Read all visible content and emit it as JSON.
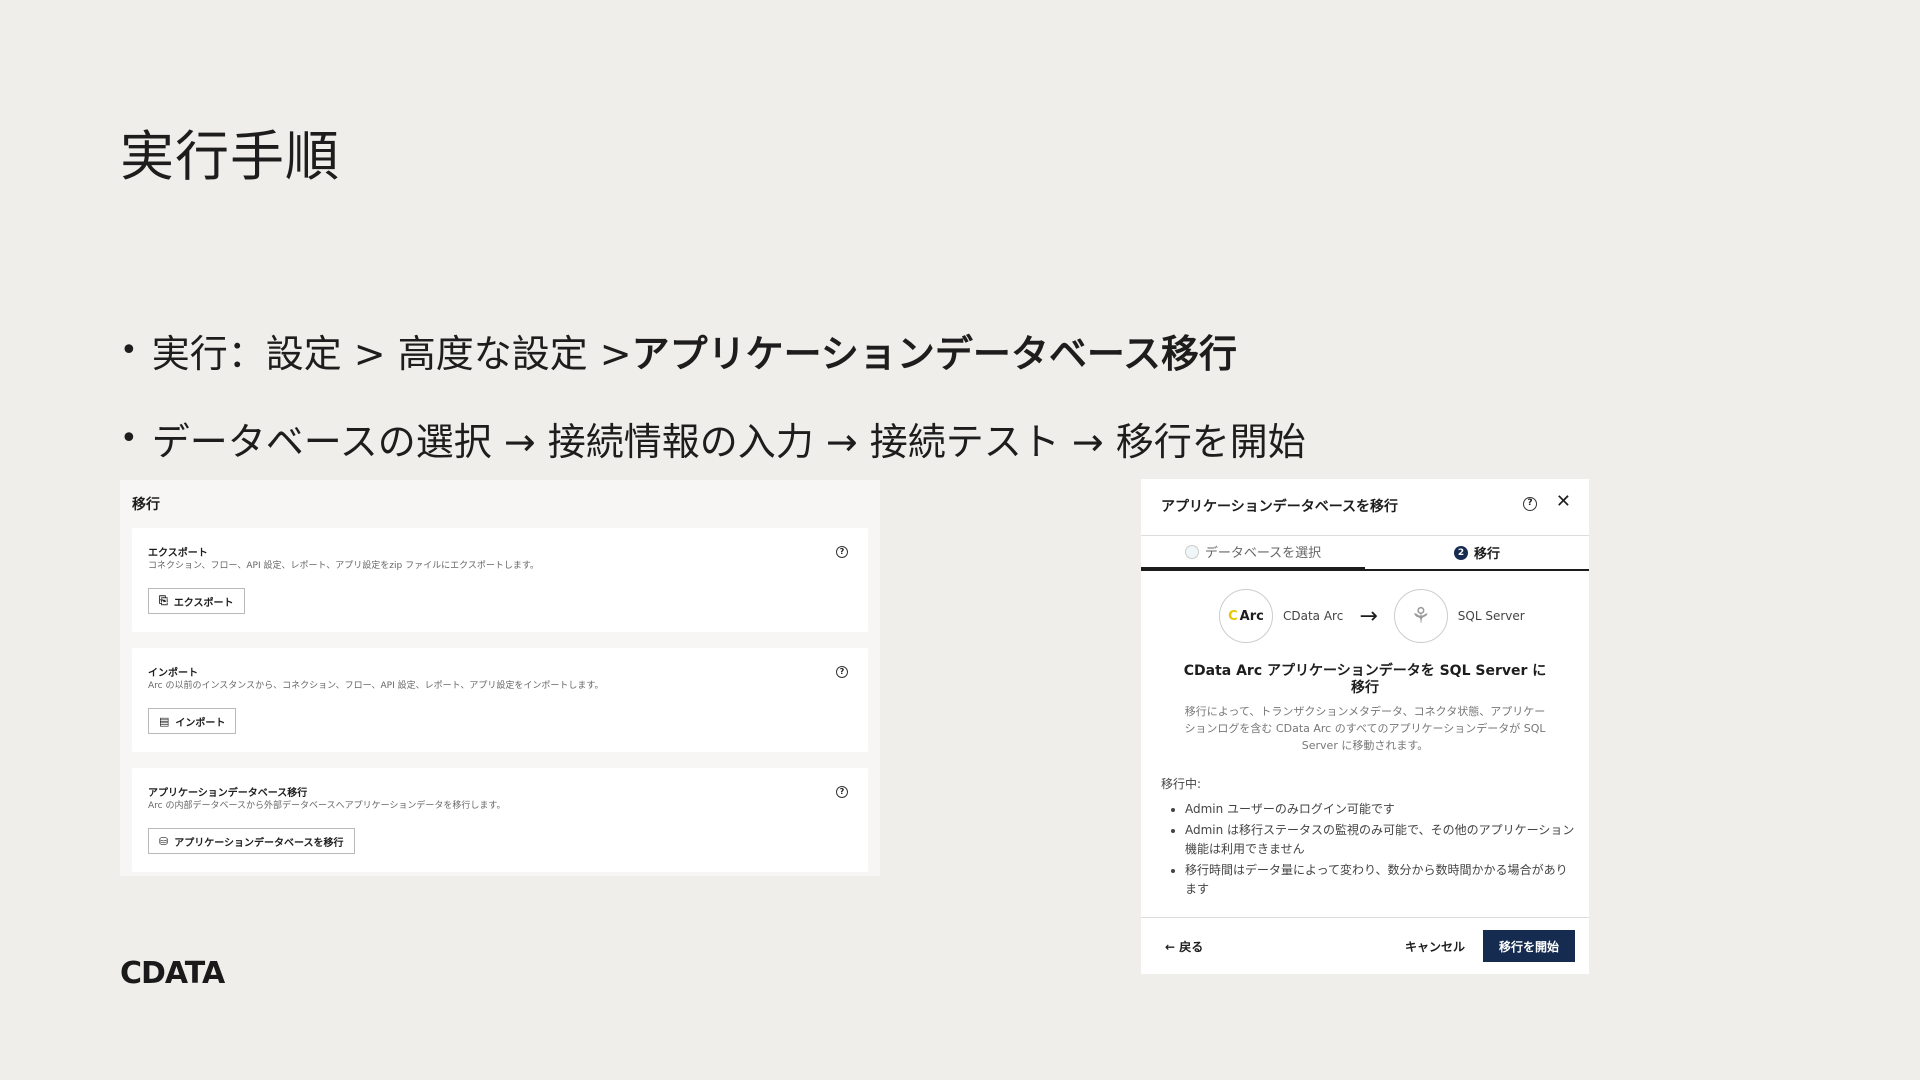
{
  "slide": {
    "title": "実行手順",
    "bullets": [
      {
        "prefix": "実行：設定 > 高度な設定 > ",
        "strong": "アプリケーションデータベース移行"
      },
      {
        "text": "データベースの選択 → 接続情報の入力 → 接続テスト → 移行を開始"
      }
    ],
    "brand": "CDATA"
  },
  "left_panel": {
    "title": "移行",
    "cards": [
      {
        "title": "エクスポート",
        "description": "コネクション、フロー、API 設定、レポート、アプリ設定をzip ファイルにエクスポートします。",
        "button": "エクスポート",
        "button_icon": "export-icon"
      },
      {
        "title": "インポート",
        "description": "Arc の以前のインスタンスから、コネクション、フロー、API 設定、レポート、アプリ設定をインポートします。",
        "button": "インポート",
        "button_icon": "import-icon"
      },
      {
        "title": "アプリケーションデータベース移行",
        "description": "Arc の内部データベースから外部データベースへアプリケーションデータを移行します。",
        "button": "アプリケーションデータベースを移行",
        "button_icon": "database-icon"
      }
    ],
    "help_glyph": "?"
  },
  "dialog": {
    "title": "アプリケーションデータベースを移行",
    "help_glyph": "?",
    "close_glyph": "✕",
    "tabs": [
      {
        "number": "",
        "label": "データベースを選択"
      },
      {
        "number": "2",
        "label": "移行"
      }
    ],
    "source_logo": "Arc",
    "source_name": "CData Arc",
    "arrow": "→",
    "target_name": "SQL Server",
    "heading": "CData Arc アプリケーションデータを SQL Server に移行",
    "description": "移行によって、トランザクションメタデータ、コネクタ状態、アプリケーションログを含む CData Arc のすべてのアプリケーションデータが SQL Server に移動されます。",
    "during_label": "移行中:",
    "notes": [
      "Admin ユーザーのみログイン可能です",
      "Admin は移行ステータスの監視のみ可能で、その他のアプリケーション機能は利用できません",
      "移行時間はデータ量によって変わり、数分から数時間かかる場合があります"
    ],
    "back_label": "← 戻る",
    "cancel_label": "キャンセル",
    "start_label": "移行を開始"
  }
}
